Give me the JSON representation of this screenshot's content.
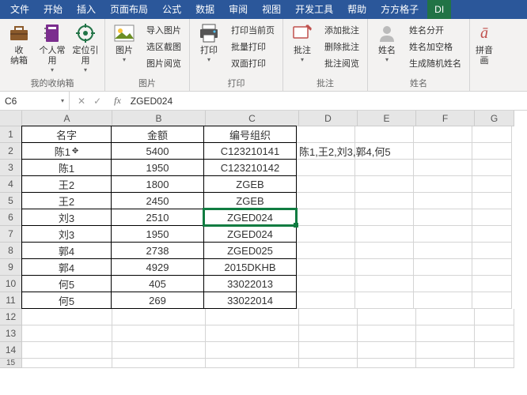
{
  "menu": {
    "file": "文件",
    "home": "开始",
    "insert": "插入",
    "layout": "页面布局",
    "formula": "公式",
    "data": "数据",
    "review": "审阅",
    "view": "视图",
    "dev": "开发工具",
    "help": "帮助",
    "ffz": "方方格子",
    "diy": "DI"
  },
  "ribbon": {
    "g1": {
      "b1": "收\n纳箱",
      "b2": "个人常\n用",
      "b3": "定位引\n用",
      "lbl": "我的收纳箱"
    },
    "g2": {
      "b1": "图片",
      "s1": "导入图片",
      "s2": "选区截图",
      "s3": "图片阅览",
      "lbl": "图片"
    },
    "g3": {
      "b1": "打印",
      "s1": "打印当前页",
      "s2": "批量打印",
      "s3": "双面打印",
      "lbl": "打印"
    },
    "g4": {
      "b1": "批注",
      "s1": "添加批注",
      "s2": "删除批注",
      "s3": "批注阅览",
      "lbl": "批注"
    },
    "g5": {
      "b1": "姓名",
      "s1": "姓名分开",
      "s2": "姓名加空格",
      "s3": "生成随机姓名",
      "lbl": "姓名"
    },
    "g6": {
      "b1": "拼音\n画"
    }
  },
  "namebox": "C6",
  "formula": "ZGED024",
  "cols": [
    "A",
    "B",
    "C",
    "D",
    "E",
    "F",
    "G"
  ],
  "headers": {
    "A": "名字",
    "B": "金额",
    "C": "编号组织"
  },
  "rows": [
    {
      "A": "陈1",
      "B": "5400",
      "C": "C123210141"
    },
    {
      "A": "陈1",
      "B": "1950",
      "C": "C123210142"
    },
    {
      "A": "王2",
      "B": "1800",
      "C": "ZGEB"
    },
    {
      "A": "王2",
      "B": "2450",
      "C": "ZGEB"
    },
    {
      "A": "刘3",
      "B": "2510",
      "C": "ZGED024"
    },
    {
      "A": "刘3",
      "B": "1950",
      "C": "ZGED024"
    },
    {
      "A": "郭4",
      "B": "2738",
      "C": "ZGED025"
    },
    {
      "A": "郭4",
      "B": "4929",
      "C": "2015DKHB"
    },
    {
      "A": "何5",
      "B": "405",
      "C": "33022013"
    },
    {
      "A": "何5",
      "B": "269",
      "C": "33022014"
    }
  ],
  "d2": "陈1,王2,刘3,郭4,何5",
  "chart_data": {
    "type": "table",
    "title": "",
    "columns": [
      "名字",
      "金额",
      "编号组织"
    ],
    "data": [
      [
        "陈1",
        5400,
        "C123210141"
      ],
      [
        "陈1",
        1950,
        "C123210142"
      ],
      [
        "王2",
        1800,
        "ZGEB"
      ],
      [
        "王2",
        2450,
        "ZGEB"
      ],
      [
        "刘3",
        2510,
        "ZGED024"
      ],
      [
        "刘3",
        1950,
        "ZGED024"
      ],
      [
        "郭4",
        2738,
        "ZGED025"
      ],
      [
        "郭4",
        4929,
        "2015DKHB"
      ],
      [
        "何5",
        405,
        "33022013"
      ],
      [
        "何5",
        269,
        "33022014"
      ]
    ]
  }
}
